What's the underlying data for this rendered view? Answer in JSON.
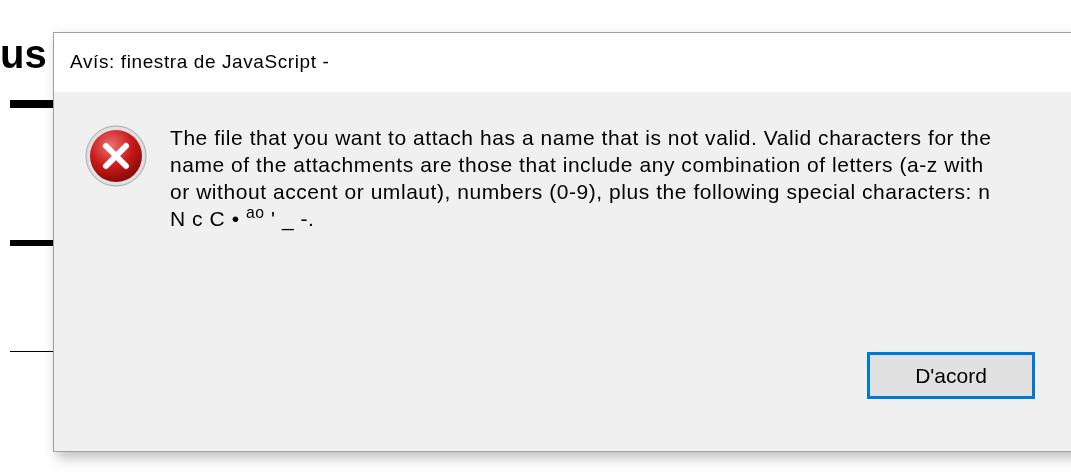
{
  "background": {
    "heading": "us"
  },
  "dialog": {
    "title": "Avís: finestra de JavaScript -",
    "message_lines": [
      "The file that you want to attach has a name that is not valid. Valid characters for the",
      "name of the attachments are those that include any combination of letters (a-z with",
      "or without accent or umlaut), numbers (0-9), plus the following special characters: n",
      "N c C • $^{ao}$ ' _ -."
    ],
    "buttons": [
      {
        "label": "D'acord",
        "selected": true
      }
    ]
  }
}
